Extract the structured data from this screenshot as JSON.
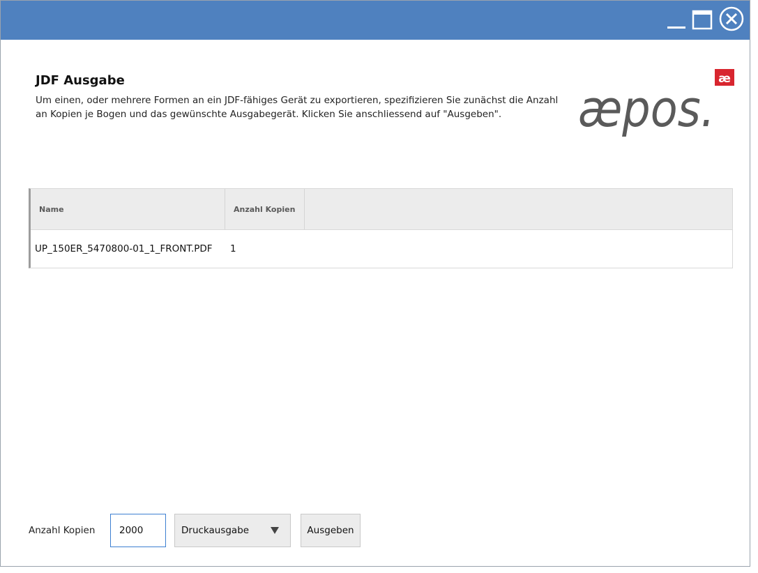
{
  "window": {
    "controls": {
      "minimize": "minimize-icon",
      "maximize": "maximize-icon",
      "close": "close-icon"
    },
    "titlebar_color": "#4f81bf"
  },
  "header": {
    "title": "JDF Ausgabe",
    "description": "Um einen, oder mehrere Formen an ein JDF-fähiges Gerät zu exportieren, spezifizieren Sie zunächst die Anzahl an Kopien je Bogen und das gewünschte Ausgabegerät. Klicken Sie anschliessend auf \"Ausgeben\"."
  },
  "logo": {
    "text": "æpos.",
    "badge": "æ",
    "accent_color": "#d8262f",
    "text_color": "#5a5a5a"
  },
  "table": {
    "columns": [
      "Name",
      "Anzahl Kopien"
    ],
    "rows": [
      {
        "name": "UP_150ER_5470800-01_1_FRONT.PDF",
        "copies": "1"
      }
    ]
  },
  "footer": {
    "copies_label": "Anzahl Kopien",
    "copies_value": "2000",
    "output_device": "Druckausgabe",
    "submit_label": "Ausgeben"
  }
}
